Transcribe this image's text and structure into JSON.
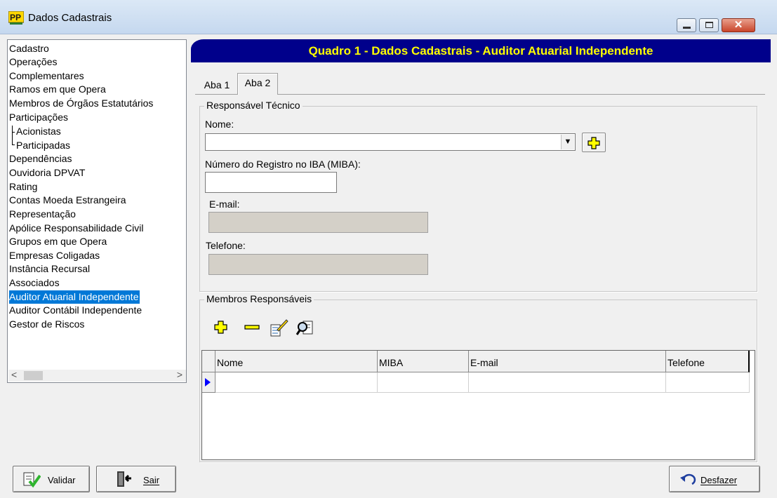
{
  "window": {
    "title": "Dados Cadastrais",
    "close_glyph": "✕"
  },
  "header": {
    "title": "Quadro 1 - Dados Cadastrais - Auditor Atuarial Independente",
    "bg_color": "#00008b",
    "text_color": "#ffff00"
  },
  "nav": {
    "items": [
      "Cadastro",
      "Operações",
      "Complementares",
      "Ramos em que Opera",
      "Membros de Órgãos Estatutários",
      "Participações",
      "Acionistas",
      "Participadas",
      "Dependências",
      "Ouvidoria DPVAT",
      "Rating",
      "Contas Moeda Estrangeira",
      "Representação",
      "Apólice Responsabilidade Civil",
      "Grupos em que Opera",
      "Empresas Coligadas",
      "Instância Recursal",
      "Associados",
      "Auditor Atuarial Independente",
      "Auditor Contábil Independente",
      "Gestor de Riscos"
    ],
    "selected": "Auditor Atuarial Independente",
    "selected_color": "#0078d7",
    "scroll_left": "<",
    "scroll_right": ">"
  },
  "buttons": {
    "validar": "Validar",
    "sair": "Sair",
    "desfazer": "Desfazer"
  },
  "tabs": {
    "tab1": "Aba 1",
    "tab2": "Aba 2",
    "active": "Aba 2"
  },
  "responsavel": {
    "group_title": "Responsável Técnico",
    "nome_label": "Nome:",
    "nome_value": "",
    "combo_arrow": "▼",
    "miba_label": "Número do Registro no IBA (MIBA):",
    "miba_value": "",
    "email_label": "E-mail:",
    "email_value": "",
    "telefone_label": "Telefone:",
    "telefone_value": ""
  },
  "membros": {
    "group_title": "Membros Responsáveis",
    "toolbar_icons": [
      "add-icon",
      "remove-icon",
      "edit-icon",
      "search-icon"
    ],
    "columns": [
      "Nome",
      "MIBA",
      "E-mail",
      "Telefone"
    ],
    "rows": [
      [
        "",
        "",
        "",
        ""
      ]
    ]
  }
}
